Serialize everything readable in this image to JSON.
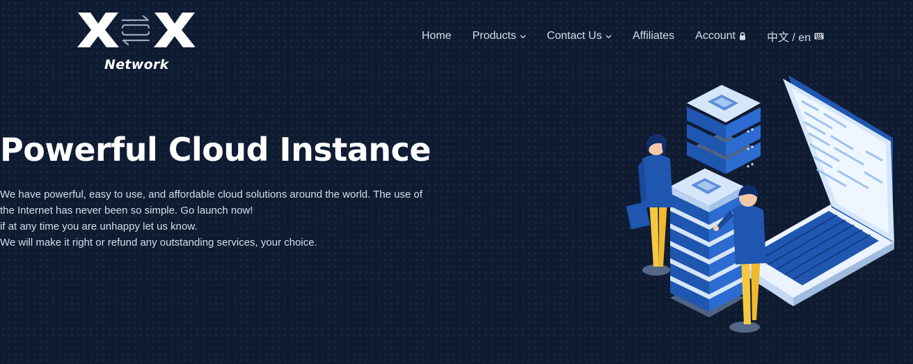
{
  "brand": {
    "logo_letters": "XSX",
    "logo_sub": "Network"
  },
  "nav": {
    "home": "Home",
    "products": "Products",
    "contact": "Contact Us",
    "affiliates": "Affiliates",
    "account": "Account",
    "language": "中文 / en"
  },
  "hero": {
    "title": "Powerful Cloud Instance",
    "lines": [
      "We have powerful, easy to use, and affordable cloud solutions around the world. The use of",
      "the Internet has never been so simple. Go launch now!",
      "if at any time you are unhappy let us know.",
      "We will make it right or refund any outstanding services, your choice."
    ]
  },
  "icons": [
    "chevron-down-icon",
    "lock-icon",
    "keyboard-icon",
    "swap-arrows-icon"
  ],
  "colors": {
    "background": "#0f1b31",
    "accent_blue": "#1e56b0",
    "light_blue": "#d5e6fb",
    "yellow": "#f5c842"
  }
}
